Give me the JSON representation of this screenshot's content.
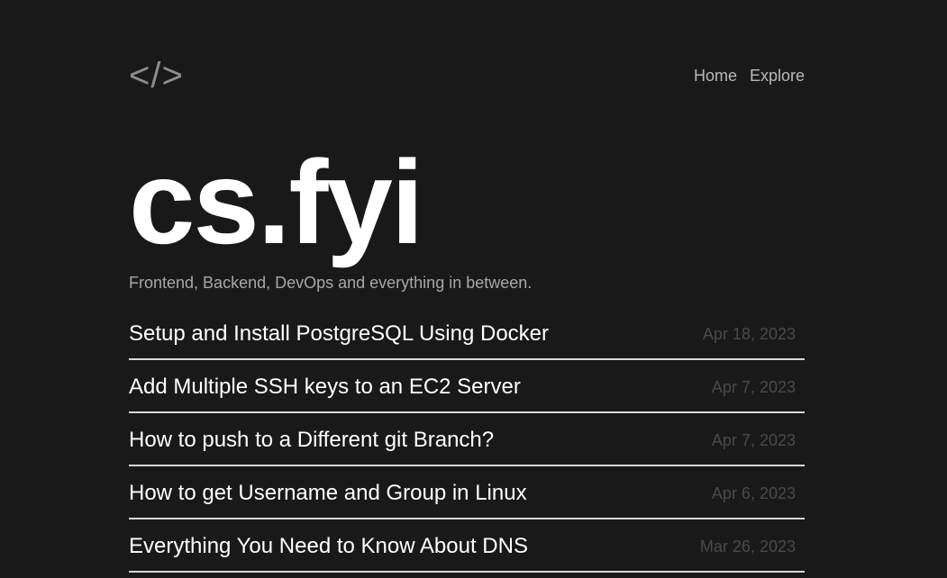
{
  "header": {
    "logo": "</>",
    "nav": [
      {
        "label": "Home"
      },
      {
        "label": "Explore"
      }
    ]
  },
  "hero": {
    "title": "cs.fyi",
    "tagline": "Frontend, Backend, DevOps and everything in between."
  },
  "posts": [
    {
      "title": "Setup and Install PostgreSQL Using Docker",
      "date": "Apr 18, 2023"
    },
    {
      "title": "Add Multiple SSH keys to an EC2 Server",
      "date": "Apr 7, 2023"
    },
    {
      "title": "How to push to a Different git Branch?",
      "date": "Apr 7, 2023"
    },
    {
      "title": "How to get Username and Group in Linux",
      "date": "Apr 6, 2023"
    },
    {
      "title": "Everything You Need to Know About DNS",
      "date": "Mar 26, 2023"
    }
  ],
  "colors": {
    "background": "#1a1919",
    "text": "#ffffff",
    "muted": "#a8a8a8",
    "date": "#4a4a4a",
    "divider": "#d7d7d7"
  }
}
